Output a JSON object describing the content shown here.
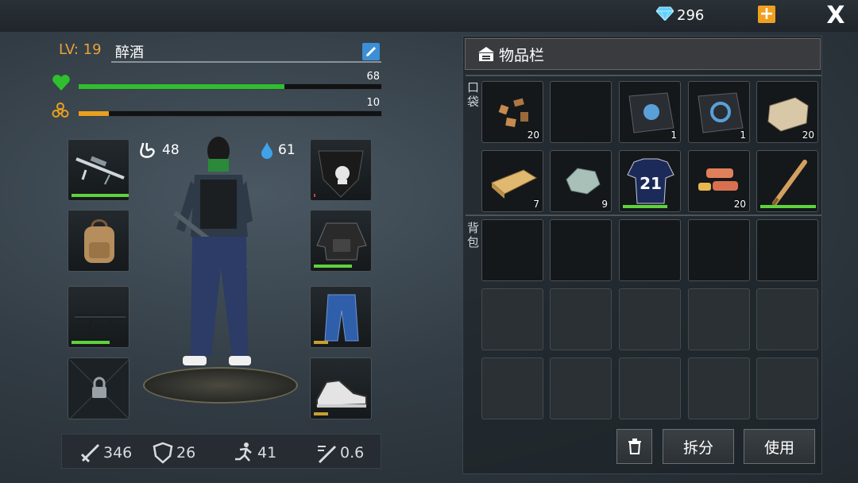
{
  "header": {
    "gems": "296",
    "plus_icon": "plus-icon",
    "close_label": "X"
  },
  "player": {
    "level_label": "LV: 19",
    "name": "醉酒",
    "health_value": "68",
    "health_fraction": 0.68,
    "radiation_value": "10",
    "radiation_fraction": 0.1,
    "food_value": "48",
    "water_value": "61",
    "colors": {
      "health": "#2fbf2f",
      "radiation": "#e8a020",
      "level": "#e8a33a"
    }
  },
  "equipment": {
    "left": [
      {
        "name": "sniper-rifle",
        "durability": 0.95
      },
      {
        "name": "backpack",
        "durability": null
      },
      {
        "name": "machine-gun",
        "durability": 0.65
      },
      {
        "name": "locked-slot",
        "durability": null
      }
    ],
    "right": [
      {
        "name": "skull-bandana",
        "durability": 0.02
      },
      {
        "name": "tactical-vest-jacket",
        "durability": 0.65
      },
      {
        "name": "jeans",
        "durability": 0.25
      },
      {
        "name": "sneakers",
        "durability": 0.25
      }
    ]
  },
  "bottom_stats": {
    "attack": "346",
    "defense": "26",
    "speed": "41",
    "attack_speed": "0.6"
  },
  "inventory": {
    "title": "物品栏",
    "pocket_label": "口袋",
    "backpack_label": "背包",
    "pocket_row1": [
      {
        "item": "scrap-parts",
        "count": "20"
      },
      {
        "item": "empty",
        "count": ""
      },
      {
        "item": "blue-book",
        "count": "1"
      },
      {
        "item": "recycle-book",
        "count": "1"
      },
      {
        "item": "stone-block",
        "count": "20"
      }
    ],
    "pocket_row2": [
      {
        "item": "wood-plank",
        "count": "7"
      },
      {
        "item": "stone",
        "count": "9"
      },
      {
        "item": "jersey-21",
        "count": "",
        "durability": 0.75
      },
      {
        "item": "clay-bricks",
        "count": "20"
      },
      {
        "item": "baseball-bat",
        "count": "",
        "durability": 0.95
      }
    ],
    "jersey_number": "21",
    "buttons": {
      "delete_icon": "trash-icon",
      "split": "拆分",
      "use": "使用"
    }
  }
}
